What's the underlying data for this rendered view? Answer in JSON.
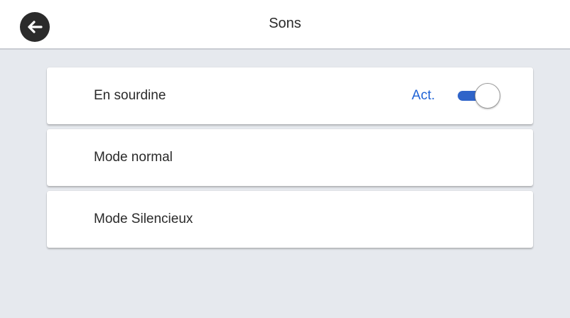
{
  "header": {
    "title": "Sons",
    "back_icon": "arrow-left-icon"
  },
  "settings": {
    "items": [
      {
        "label": "En sourdine",
        "value": "Act.",
        "toggle_on": true
      },
      {
        "label": "Mode normal"
      },
      {
        "label": "Mode Silencieux"
      }
    ]
  },
  "colors": {
    "accent": "#2f64c9",
    "value_text": "#1f63d6",
    "background": "#e6e9ee"
  }
}
